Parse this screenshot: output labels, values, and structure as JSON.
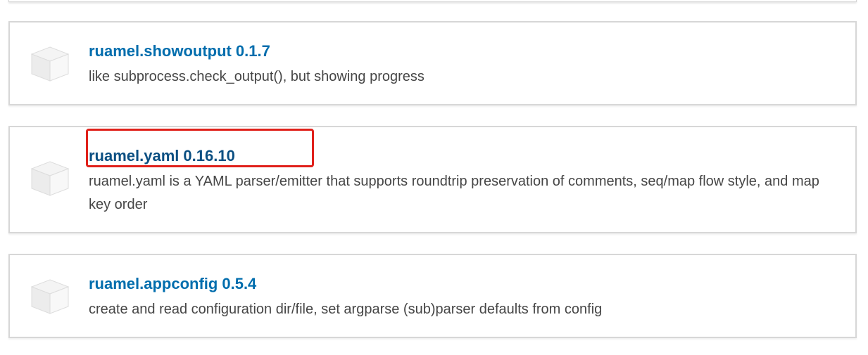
{
  "packages": [
    {
      "name": "ruamel.showoutput",
      "version": "0.1.7",
      "description": "like subprocess.check_output(), but showing progress"
    },
    {
      "name": "ruamel.yaml",
      "version": "0.16.10",
      "description": "ruamel.yaml is a YAML parser/emitter that supports roundtrip preservation of comments, seq/map flow style, and map key order"
    },
    {
      "name": "ruamel.appconfig",
      "version": "0.5.4",
      "description": "create and read configuration dir/file, set argparse (sub)parser defaults from config"
    }
  ],
  "colors": {
    "link": "#006dad",
    "highlight": "#e0201a",
    "card_border": "#d7d7d7",
    "text": "#464646"
  },
  "icons": {
    "package": "package-box-icon"
  }
}
